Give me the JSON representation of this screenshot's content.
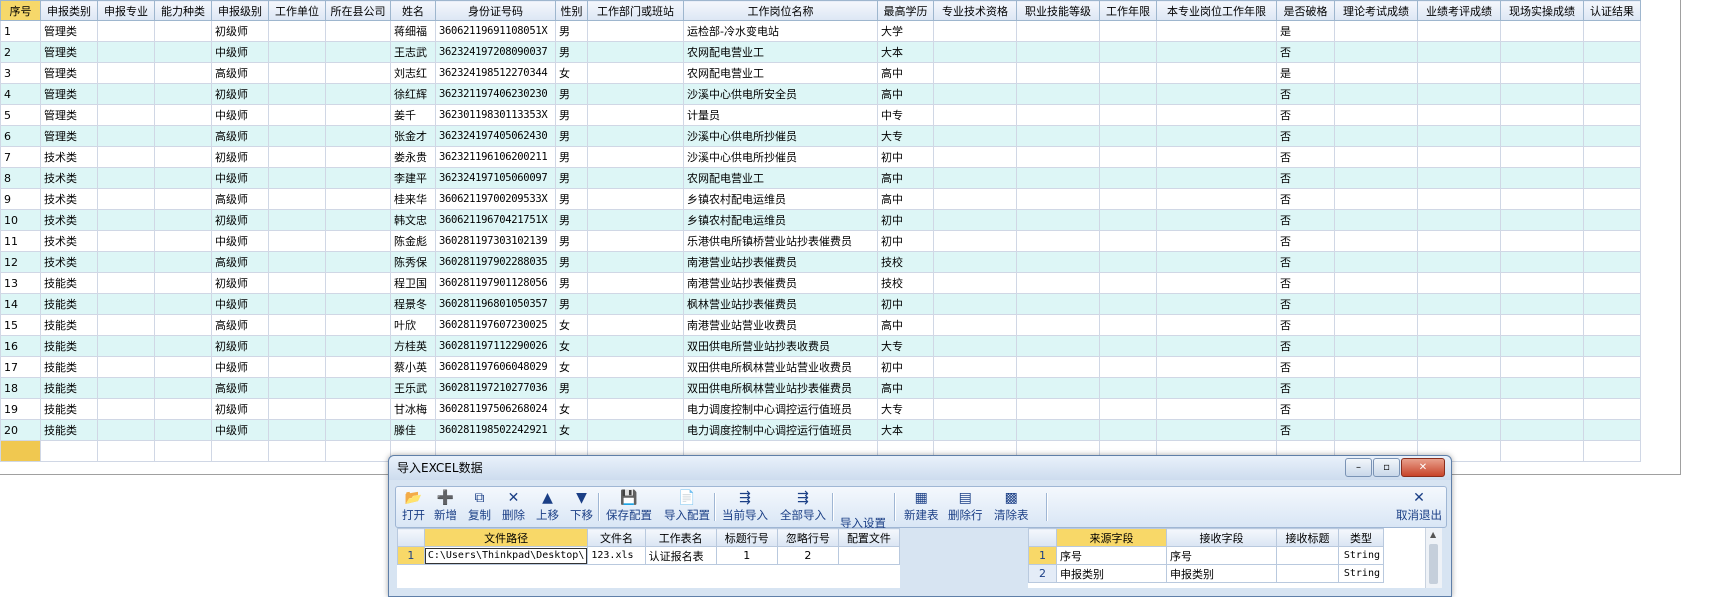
{
  "main_grid": {
    "columns": [
      "序号",
      "申报类别",
      "申报专业",
      "能力种类",
      "申报级别",
      "工作单位",
      "所在县公司",
      "姓名",
      "身份证号码",
      "性别",
      "工作部门或班站",
      "工作岗位名称",
      "最高学历",
      "专业技术资格",
      "职业技能等级",
      "工作年限",
      "本专业岗位工作年限",
      "是否破格",
      "理论考试成绩",
      "业绩考评成绩",
      "现场实操成绩",
      "认证结果"
    ],
    "rows": [
      {
        "no": "1",
        "cat": "管理类",
        "level": "初级师",
        "name": "蒋细福",
        "id": "36062119691108051X",
        "sex": "男",
        "post": "运检部-冷水变电站",
        "edu": "大学",
        "exception": "是"
      },
      {
        "no": "2",
        "cat": "管理类",
        "level": "中级师",
        "name": "王志武",
        "id": "362324197208090037",
        "sex": "男",
        "post": "农网配电营业工",
        "edu": "大本",
        "exception": "否"
      },
      {
        "no": "3",
        "cat": "管理类",
        "level": "高级师",
        "name": "刘志红",
        "id": "362324198512270344",
        "sex": "女",
        "post": "农网配电营业工",
        "edu": "高中",
        "exception": "是"
      },
      {
        "no": "4",
        "cat": "管理类",
        "level": "初级师",
        "name": "徐红辉",
        "id": "362321197406230230",
        "sex": "男",
        "post": "沙溪中心供电所安全员",
        "edu": "高中",
        "exception": "否"
      },
      {
        "no": "5",
        "cat": "管理类",
        "level": "中级师",
        "name": "姜千",
        "id": "36230119830113353X",
        "sex": "男",
        "post": "计量员",
        "edu": "中专",
        "exception": "否"
      },
      {
        "no": "6",
        "cat": "管理类",
        "level": "高级师",
        "name": "张金才",
        "id": "362324197405062430",
        "sex": "男",
        "post": "沙溪中心供电所抄催员",
        "edu": "大专",
        "exception": "否"
      },
      {
        "no": "7",
        "cat": "技术类",
        "level": "初级师",
        "name": "娄永贵",
        "id": "362321196106200211",
        "sex": "男",
        "post": "沙溪中心供电所抄催员",
        "edu": "初中",
        "exception": "否"
      },
      {
        "no": "8",
        "cat": "技术类",
        "level": "中级师",
        "name": "李建平",
        "id": "362324197105060097",
        "sex": "男",
        "post": "农网配电营业工",
        "edu": "高中",
        "exception": "否"
      },
      {
        "no": "9",
        "cat": "技术类",
        "level": "高级师",
        "name": "桂来华",
        "id": "36062119700209533X",
        "sex": "男",
        "post": "乡镇农村配电运维员",
        "edu": "高中",
        "exception": "否"
      },
      {
        "no": "10",
        "cat": "技术类",
        "level": "初级师",
        "name": "韩文忠",
        "id": "36062119670421751X",
        "sex": "男",
        "post": "乡镇农村配电运维员",
        "edu": "初中",
        "exception": "否"
      },
      {
        "no": "11",
        "cat": "技术类",
        "level": "中级师",
        "name": "陈金彪",
        "id": "360281197303102139",
        "sex": "男",
        "post": "乐港供电所镇桥营业站抄表催费员",
        "edu": "初中",
        "exception": "否"
      },
      {
        "no": "12",
        "cat": "技术类",
        "level": "高级师",
        "name": "陈秀保",
        "id": "360281197902288035",
        "sex": "男",
        "post": "南港营业站抄表催费员",
        "edu": "技校",
        "exception": "否"
      },
      {
        "no": "13",
        "cat": "技能类",
        "level": "初级师",
        "name": "程卫国",
        "id": "360281197901128056",
        "sex": "男",
        "post": "南港营业站抄表催费员",
        "edu": "技校",
        "exception": "否"
      },
      {
        "no": "14",
        "cat": "技能类",
        "level": "中级师",
        "name": "程景冬",
        "id": "360281196801050357",
        "sex": "男",
        "post": "枫林营业站抄表催费员",
        "edu": "初中",
        "exception": "否"
      },
      {
        "no": "15",
        "cat": "技能类",
        "level": "高级师",
        "name": "叶欣",
        "id": "360281197607230025",
        "sex": "女",
        "post": "南港营业站营业收费员",
        "edu": "高中",
        "exception": "否"
      },
      {
        "no": "16",
        "cat": "技能类",
        "level": "初级师",
        "name": "方桂英",
        "id": "360281197112290026",
        "sex": "女",
        "post": "双田供电所营业站抄表收费员",
        "edu": "大专",
        "exception": "否"
      },
      {
        "no": "17",
        "cat": "技能类",
        "level": "中级师",
        "name": "蔡小英",
        "id": "360281197606048029",
        "sex": "女",
        "post": "双田供电所枫林营业站营业收费员",
        "edu": "初中",
        "exception": "否"
      },
      {
        "no": "18",
        "cat": "技能类",
        "level": "高级师",
        "name": "王乐武",
        "id": "360281197210277036",
        "sex": "男",
        "post": "双田供电所枫林营业站抄表催费员",
        "edu": "高中",
        "exception": "否"
      },
      {
        "no": "19",
        "cat": "技能类",
        "level": "初级师",
        "name": "甘冰梅",
        "id": "360281197506268024",
        "sex": "女",
        "post": "电力调度控制中心调控运行值班员",
        "edu": "大专",
        "exception": "否"
      },
      {
        "no": "20",
        "cat": "技能类",
        "level": "中级师",
        "name": "滕佳",
        "id": "360281198502242921",
        "sex": "女",
        "post": "电力调度控制中心调控运行值班员",
        "edu": "大本",
        "exception": "否"
      }
    ]
  },
  "dialog": {
    "title": "导入EXCEL数据",
    "window_buttons": {
      "minimize": "–",
      "restore": "▫",
      "close": "✕"
    },
    "toolbar": [
      {
        "label": "打开",
        "icon": "folder-open-icon",
        "glyph": "📂"
      },
      {
        "label": "新增",
        "icon": "add-icon",
        "glyph": "➕"
      },
      {
        "label": "复制",
        "icon": "copy-icon",
        "glyph": "⧉"
      },
      {
        "label": "删除",
        "icon": "delete-x-icon",
        "glyph": "✕"
      },
      {
        "label": "上移",
        "icon": "arrow-up-icon",
        "glyph": "▲"
      },
      {
        "label": "下移",
        "icon": "arrow-down-icon",
        "glyph": "▼"
      },
      {
        "label": "保存配置",
        "icon": "save-icon",
        "glyph": "💾"
      },
      {
        "label": "导入配置",
        "icon": "import-config-icon",
        "glyph": "📄"
      },
      {
        "label": "当前导入",
        "icon": "import-current-icon",
        "glyph": "⇶"
      },
      {
        "label": "全部导入",
        "icon": "import-all-icon",
        "glyph": "⇶"
      },
      {
        "label": "导入设置",
        "icon": "",
        "glyph": ""
      },
      {
        "label": "新建表",
        "icon": "new-table-icon",
        "glyph": "▦"
      },
      {
        "label": "删除行",
        "icon": "delete-row-icon",
        "glyph": "▤"
      },
      {
        "label": "清除表",
        "icon": "clear-table-icon",
        "glyph": "▩"
      },
      {
        "label": "取消退出",
        "icon": "close-icon",
        "glyph": "✕"
      }
    ],
    "files_grid": {
      "columns": [
        "文件路径",
        "文件名",
        "工作表名",
        "标题行号",
        "忽略行号",
        "配置文件"
      ],
      "rows": [
        {
          "rn": "1",
          "path": "C:\\Users\\Thinkpad\\Desktop\\",
          "file": "123.xls",
          "sheet": "认证报名表",
          "title_row": "1",
          "ignore_row": "2",
          "config": ""
        }
      ]
    },
    "fields_grid": {
      "columns": [
        "来源字段",
        "接收字段",
        "接收标题",
        "类型"
      ],
      "rows": [
        {
          "rn": "1",
          "src": "序号",
          "dst": "序号",
          "title": "",
          "type": "String"
        },
        {
          "rn": "2",
          "src": "申报类别",
          "dst": "申报类别",
          "title": "",
          "type": "String"
        }
      ]
    }
  }
}
